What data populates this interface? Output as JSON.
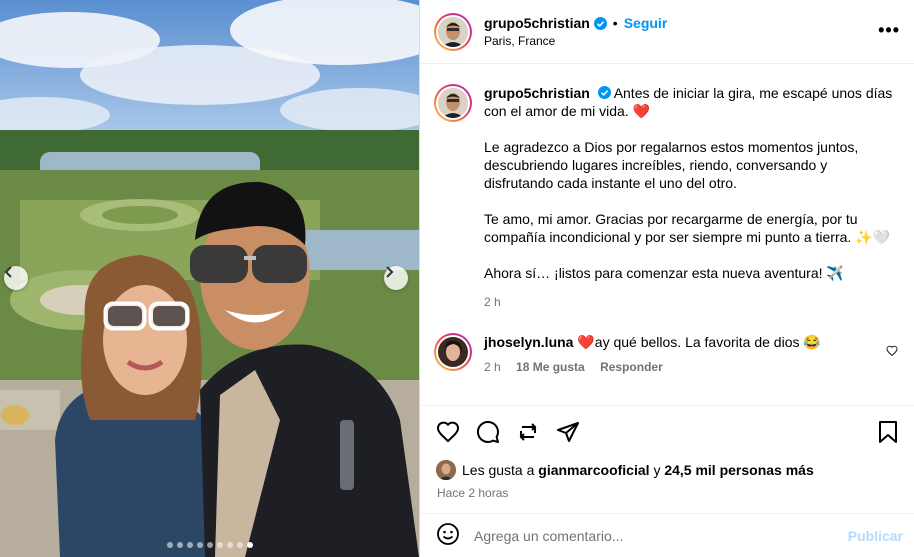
{
  "post": {
    "author": "grupo5christian",
    "follow_label": "Seguir",
    "location": "Paris, France",
    "more_label": "•••",
    "carousel_dot_count": 9,
    "carousel_active_index": 8
  },
  "caption": {
    "username": "grupo5christian",
    "paragraphs": [
      "Antes de iniciar la gira, me escapé unos días con el amor de mi vida. ❤️",
      "Le agradezco a Dios por regalarnos estos momentos juntos, descubriendo lugares increíbles, riendo, conversando y disfrutando cada instante el uno del otro.",
      "Te amo, mi amor. Gracias por recargarme de energía, por tu compañía incondicional y por ser siempre mi punto a tierra. ✨🤍",
      "Ahora sí… ¡listos para comenzar esta nueva aventura! ✈️"
    ],
    "time": "2 h"
  },
  "comments": [
    {
      "username": "jhoselyn.luna",
      "text": "❤️ay qué bellos. La favorita de dios 😂",
      "time": "2 h",
      "likes": "18 Me gusta",
      "reply_label": "Responder"
    }
  ],
  "likes": {
    "prefix": "Les gusta a ",
    "user": "gianmarcooficial",
    "connector": " y ",
    "others": "24,5 mil personas más"
  },
  "posted_ago": "Hace 2 horas",
  "comment_box": {
    "placeholder": "Agrega un comentario...",
    "publish_label": "Publicar"
  },
  "colors": {
    "accent": "#0095f6",
    "verified": "#0095f6",
    "secondary_text": "#737373",
    "publish_disabled": "#b3dbff"
  }
}
